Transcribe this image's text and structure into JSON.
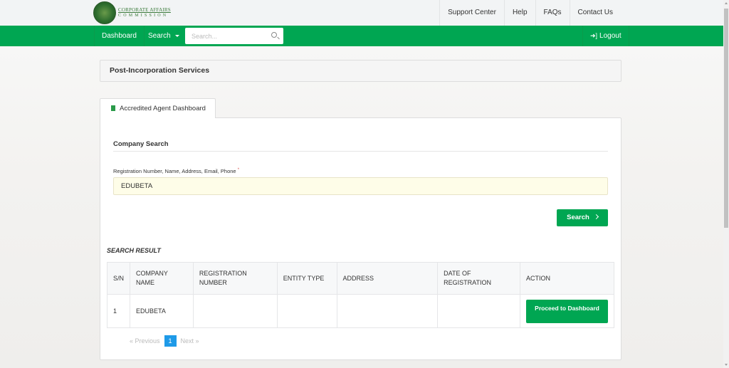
{
  "brand": {
    "line1": "CORPORATE AFFAIRS",
    "line2": "COMMISSION",
    "seal_label": "CAC"
  },
  "top_links": [
    "Support Center",
    "Help",
    "FAQs",
    "Contact Us"
  ],
  "navbar": {
    "dashboard": "Dashboard",
    "search": "Search",
    "search_placeholder": "Search...",
    "logout": "Logout",
    "accent": "#00a652"
  },
  "page_title": "Post-Incorporation Services",
  "tab": {
    "label": "Accredited Agent Dashboard",
    "icon": "building-icon"
  },
  "company_search": {
    "section_title": "Company Search",
    "field_label": "Registration Number, Name, Address, Email, Phone",
    "required_mark": "*",
    "field_value": "EDUBETA",
    "search_button": "Search"
  },
  "results": {
    "title": "SEARCH RESULT",
    "columns": [
      "S/N",
      "COMPANY NAME",
      "REGISTRATION NUMBER",
      "ENTITY TYPE",
      "ADDRESS",
      "DATE OF REGISTRATION",
      "ACTION"
    ],
    "rows": [
      {
        "sn": "1",
        "company_name": "EDUBETA",
        "registration_number": "",
        "entity_type": "",
        "address": "",
        "date_of_registration": "",
        "action": "Proceed to Dashboard"
      }
    ]
  },
  "pagination": {
    "previous": "« Previous",
    "current": "1",
    "next": "Next »",
    "active_color": "#1e9ae8"
  }
}
